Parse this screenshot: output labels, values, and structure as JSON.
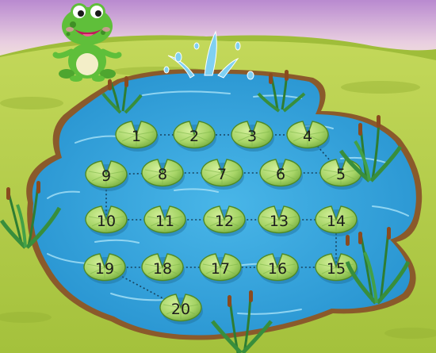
{
  "game": {
    "pads": [
      {
        "label": "1"
      },
      {
        "label": "2"
      },
      {
        "label": "3"
      },
      {
        "label": "4"
      },
      {
        "label": "5"
      },
      {
        "label": "6"
      },
      {
        "label": "7"
      },
      {
        "label": "8"
      },
      {
        "label": "9"
      },
      {
        "label": "10"
      },
      {
        "label": "11"
      },
      {
        "label": "12"
      },
      {
        "label": "13"
      },
      {
        "label": "14"
      },
      {
        "label": "15"
      },
      {
        "label": "16"
      },
      {
        "label": "17"
      },
      {
        "label": "18"
      },
      {
        "label": "19"
      },
      {
        "label": "20"
      }
    ],
    "characters": {
      "frog": "frog-character"
    },
    "colors": {
      "sky_top": "#c79ad6",
      "sky_bottom": "#f3e9d0",
      "grass": "#b4cc48",
      "grass_dark": "#8fae32",
      "pond": "#3aa7df",
      "pond_light": "#7fd0f2",
      "shore": "#8a5a2b",
      "lily": "#9fd15e",
      "lily_dark": "#5f9a2c",
      "frog": "#5fbf3a"
    }
  }
}
